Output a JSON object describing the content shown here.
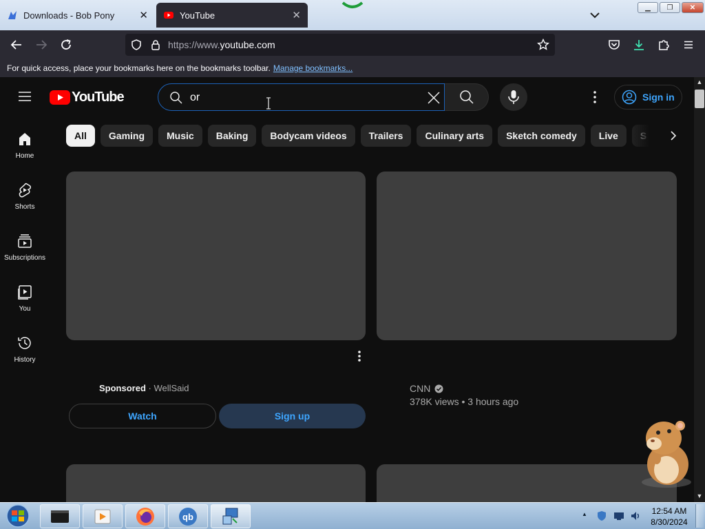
{
  "browser": {
    "tabs": [
      {
        "title": "Downloads - Bob Pony",
        "active": false
      },
      {
        "title": "YouTube",
        "active": true
      }
    ],
    "url": {
      "dim": "https://www.",
      "host": "youtube.com"
    },
    "bookmarks_hint": "For quick access, place your bookmarks here on the bookmarks toolbar.",
    "bookmarks_link": "Manage bookmarks..."
  },
  "youtube": {
    "logo_text": "YouTube",
    "search_value": "or",
    "sign_in": "Sign in",
    "guide": [
      {
        "label": "Home",
        "icon": "home-icon"
      },
      {
        "label": "Shorts",
        "icon": "shorts-icon"
      },
      {
        "label": "Subscriptions",
        "icon": "subscriptions-icon"
      },
      {
        "label": "You",
        "icon": "you-icon"
      },
      {
        "label": "History",
        "icon": "history-icon"
      }
    ],
    "chips": [
      "All",
      "Gaming",
      "Music",
      "Baking",
      "Bodycam videos",
      "Trailers",
      "Culinary arts",
      "Sketch comedy",
      "Live",
      "S"
    ],
    "ad": {
      "sponsored": "Sponsored",
      "separator": " · ",
      "advertiser": "WellSaid",
      "watch": "Watch",
      "signup": "Sign up"
    },
    "video": {
      "channel": "CNN",
      "stats": "378K views • 3 hours ago"
    }
  },
  "taskbar": {
    "clock_time": "12:54 AM",
    "clock_date": "8/30/2024",
    "apps": [
      "terminal-app",
      "media-player-app",
      "firefox-app",
      "qbittorrent-app",
      "network-app"
    ]
  },
  "colors": {
    "accent": "#3ea6ff",
    "youtube_red": "#ff0000",
    "page_bg": "#0f0f0f",
    "chrome_bg": "#2b2a33"
  }
}
